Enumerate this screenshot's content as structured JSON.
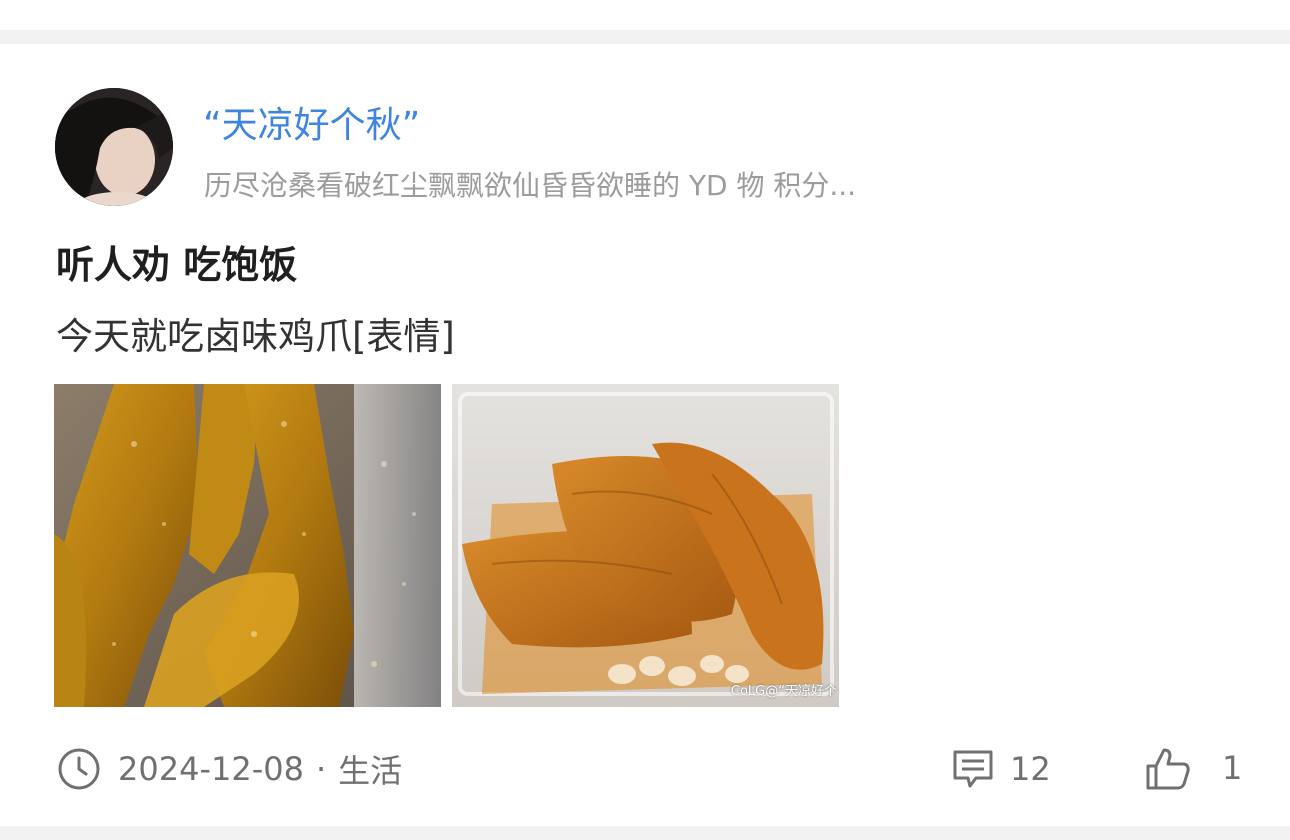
{
  "post": {
    "author": {
      "name": "“天凉好个秋”",
      "signature": "历尽沧桑看破红尘飘飘欲仙昏昏欲睡的 YD 物  积分..."
    },
    "title": "听人劝 吃饱饭",
    "body": "今天就吃卤味鸡爪[表情]",
    "images": [
      {
        "alt": "braised chicken feet close-up"
      },
      {
        "alt": "braised chicken feet in container",
        "watermark": "CoLG@“天凉好个"
      }
    ],
    "date": "2024-12-08",
    "separator": "·",
    "category": "生活",
    "comment_count": "12",
    "like_count": "1"
  },
  "icons": {
    "time": "clock-icon",
    "comment": "comment-icon",
    "like": "thumbs-up-icon"
  },
  "colors": {
    "username": "#3e84e0",
    "title": "#1f1f1f",
    "meta": "#707070",
    "background": "#f2f2f2"
  }
}
